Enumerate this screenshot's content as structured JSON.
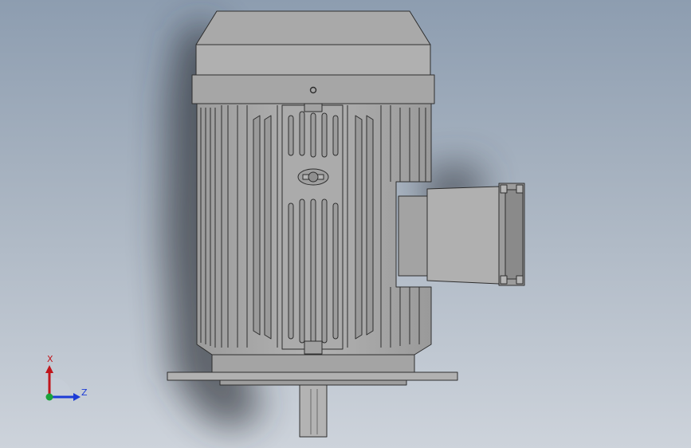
{
  "viewport": {
    "background_top": "#8d9db0",
    "background_bottom": "#cdd3db",
    "model_fill": "#a8a8a8",
    "model_edge": "#2e2e2e"
  },
  "triad": {
    "x_label": "X",
    "z_label": "Z",
    "x_color": "#c0151b",
    "y_color": "#1aa33a",
    "z_color": "#1c3bd6"
  }
}
